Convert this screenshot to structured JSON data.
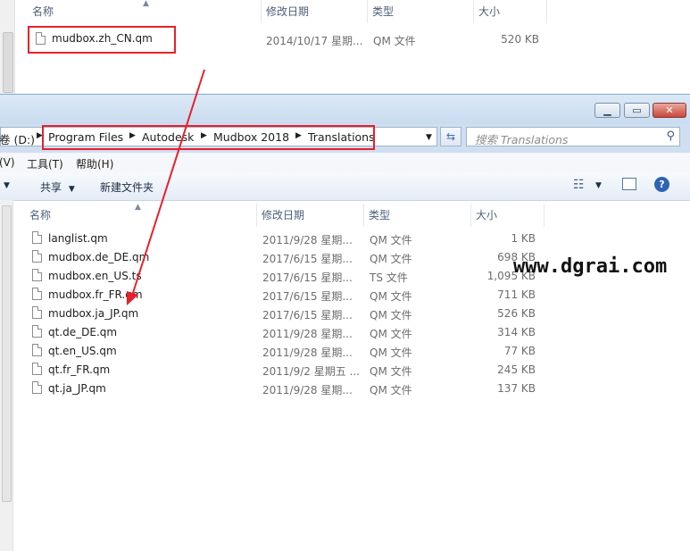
{
  "columns": {
    "name": "名称",
    "modified": "修改日期",
    "type": "类型",
    "size": "大小"
  },
  "top_window": {
    "file": {
      "name": "mudbox.zh_CN.qm",
      "modified": "2014/10/17 星期...",
      "type": "QM 文件",
      "size": "520 KB"
    }
  },
  "address_bar": {
    "drive": "卷 (D:)",
    "crumbs": [
      "Program Files",
      "Autodesk",
      "Mudbox 2018",
      "Translations"
    ]
  },
  "search": {
    "placeholder": "搜索 Translations"
  },
  "menu": [
    "(V)",
    "工具(T)",
    "帮助(H)"
  ],
  "toolbar": {
    "share": "共享",
    "new_folder": "新建文件夹"
  },
  "files": [
    {
      "name": "langlist.qm",
      "modified": "2011/9/28 星期...",
      "type": "QM 文件",
      "size": "1 KB"
    },
    {
      "name": "mudbox.de_DE.qm",
      "modified": "2017/6/15 星期...",
      "type": "QM 文件",
      "size": "698 KB"
    },
    {
      "name": "mudbox.en_US.ts",
      "modified": "2017/6/15 星期...",
      "type": "TS 文件",
      "size": "1,095 KB"
    },
    {
      "name": "mudbox.fr_FR.qm",
      "modified": "2017/6/15 星期...",
      "type": "QM 文件",
      "size": "711 KB"
    },
    {
      "name": "mudbox.ja_JP.qm",
      "modified": "2017/6/15 星期...",
      "type": "QM 文件",
      "size": "526 KB"
    },
    {
      "name": "qt.de_DE.qm",
      "modified": "2011/9/28 星期...",
      "type": "QM 文件",
      "size": "314 KB"
    },
    {
      "name": "qt.en_US.qm",
      "modified": "2011/9/28 星期...",
      "type": "QM 文件",
      "size": "77 KB"
    },
    {
      "name": "qt.fr_FR.qm",
      "modified": "2011/9/2 星期五 ...",
      "type": "QM 文件",
      "size": "245 KB"
    },
    {
      "name": "qt.ja_JP.qm",
      "modified": "2011/9/28 星期...",
      "type": "QM 文件",
      "size": "137 KB"
    }
  ],
  "watermark": "www.dgrai.com",
  "colors": {
    "annotation_red": "#e8202b",
    "title_bar": "#c9dcf0",
    "header_text": "#4c607a"
  }
}
